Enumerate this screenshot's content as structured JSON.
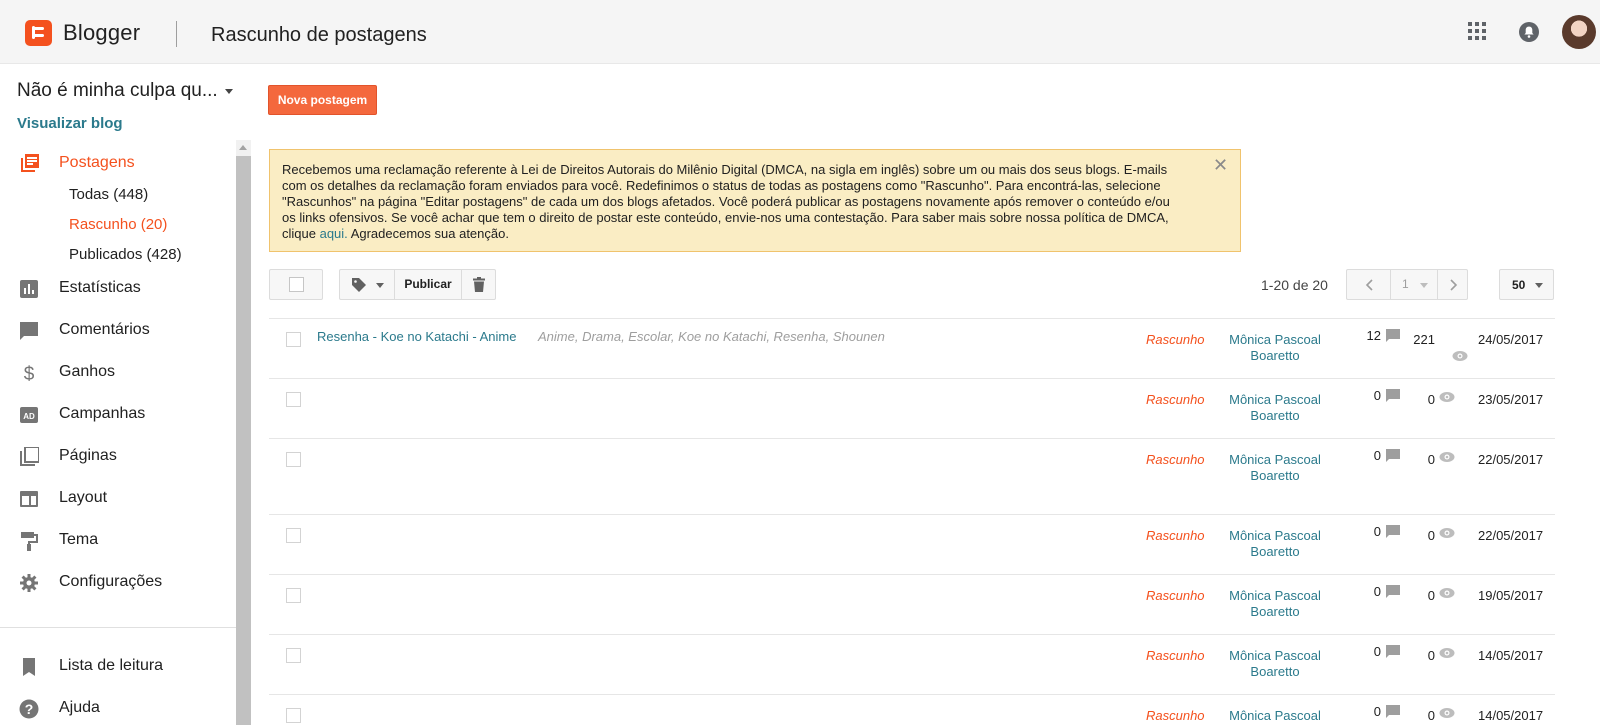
{
  "header": {
    "brand": "Blogger",
    "page_title": "Rascunho de postagens"
  },
  "blog": {
    "name": "Não é minha culpa qu...",
    "view_blog": "Visualizar blog"
  },
  "new_post_label": "Nova postagem",
  "nav": {
    "posts": "Postagens",
    "sub": [
      {
        "label": "Todas (448)"
      },
      {
        "label": "Rascunho (20)"
      },
      {
        "label": "Publicados (428)"
      }
    ],
    "stats": "Estatísticas",
    "comments": "Comentários",
    "earnings": "Ganhos",
    "campaigns": "Campanhas",
    "pages": "Páginas",
    "layout": "Layout",
    "theme": "Tema",
    "settings": "Configurações",
    "reading_list": "Lista de leitura",
    "help": "Ajuda"
  },
  "notice": {
    "text": "Recebemos uma reclamação referente à Lei de Direitos Autorais do Milênio Digital (DMCA, na sigla em inglês) sobre um ou mais dos seus blogs. E-mails com os detalhes da reclamação foram enviados para você. Redefinimos o status de todas as postagens como \"Rascunho\". Para encontrá-las, selecione \"Rascunhos\" na página \"Editar postagens\" de cada um dos blogs afetados. Você poderá publicar as postagens novamente após remover o conteúdo e/ou os links ofensivos. Se você achar que tem o direito de postar este conteúdo, envie-nos uma contestação. Para saber mais sobre nossa política de DMCA, clique",
    "link": "aqui.",
    "after": " Agradecemos sua atenção.",
    "close": "✕"
  },
  "toolbar": {
    "publish_label": "Publicar",
    "count_text": "1-20 de 20",
    "page_number": "1",
    "per_page": "50"
  },
  "posts": [
    {
      "title": "Resenha - Koe no Katachi - Anime",
      "labels": "Anime, Drama, Escolar, Koe no Katachi, Resenha, Shounen",
      "status": "Rascunho",
      "author": "Mônica Pascoal Boaretto",
      "comments": "12",
      "views": "221",
      "date": "24/05/2017"
    },
    {
      "title": "",
      "labels": "",
      "status": "Rascunho",
      "author": "Mônica Pascoal Boaretto",
      "comments": "0",
      "views": "0",
      "date": "23/05/2017"
    },
    {
      "title": "",
      "labels": "",
      "status": "Rascunho",
      "author": "Mônica Pascoal Boaretto",
      "comments": "0",
      "views": "0",
      "date": "22/05/2017"
    },
    {
      "title": "",
      "labels": "",
      "status": "Rascunho",
      "author": "Mônica Pascoal Boaretto",
      "comments": "0",
      "views": "0",
      "date": "22/05/2017"
    },
    {
      "title": "",
      "labels": "",
      "status": "Rascunho",
      "author": "Mônica Pascoal Boaretto",
      "comments": "0",
      "views": "0",
      "date": "19/05/2017"
    },
    {
      "title": "",
      "labels": "",
      "status": "Rascunho",
      "author": "Mônica Pascoal Boaretto",
      "comments": "0",
      "views": "0",
      "date": "14/05/2017"
    },
    {
      "title": "",
      "labels": "",
      "status": "Rascunho",
      "author": "Mônica Pascoal",
      "comments": "0",
      "views": "0",
      "date": "14/05/2017"
    }
  ],
  "colors": {
    "accent": "#f4511e",
    "link": "#2b7a8c",
    "notice_bg": "#faedc4"
  }
}
